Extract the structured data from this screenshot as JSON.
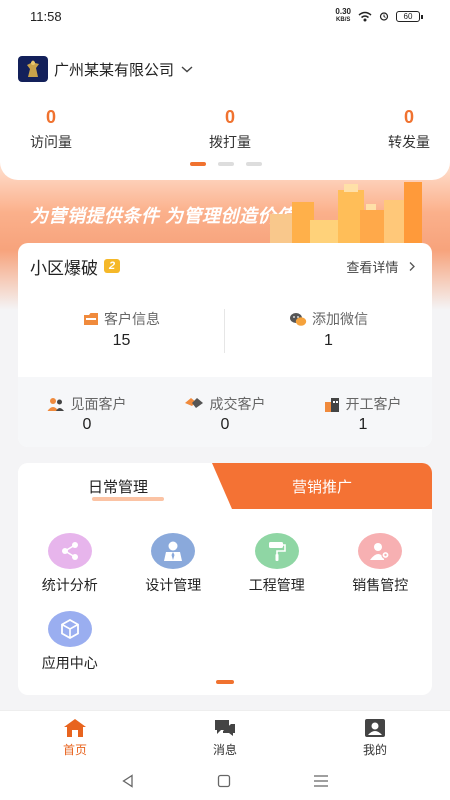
{
  "status_bar": {
    "time": "11:58",
    "net_speed_value": "0.30",
    "net_speed_unit": "KB/S",
    "battery": "60"
  },
  "header": {
    "company_name": "广州某某有限公司",
    "stats": [
      {
        "value": "0",
        "label": "访问量"
      },
      {
        "value": "0",
        "label": "拨打量"
      },
      {
        "value": "0",
        "label": "转发量"
      }
    ]
  },
  "banner": {
    "slogan": "为营销提供条件 为管理创造价值"
  },
  "project": {
    "title": "小区爆破",
    "badge": "2",
    "details_link": "查看详情",
    "customer_info": {
      "label": "客户信息",
      "value": "15"
    },
    "add_wechat": {
      "label": "添加微信",
      "value": "1"
    },
    "meet_customers": {
      "label": "见面客户",
      "value": "0"
    },
    "deal_customers": {
      "label": "成交客户",
      "value": "0"
    },
    "start_customers": {
      "label": "开工客户",
      "value": "1"
    }
  },
  "management": {
    "tabs": {
      "daily": "日常管理",
      "marketing": "营销推广"
    },
    "items": [
      {
        "label": "统计分析",
        "icon": "share-nodes-icon",
        "color": "#e7b5ec"
      },
      {
        "label": "设计管理",
        "icon": "designer-icon",
        "color": "#8aa9db"
      },
      {
        "label": "工程管理",
        "icon": "paint-roller-icon",
        "color": "#8fd6a4"
      },
      {
        "label": "销售管控",
        "icon": "user-gear-icon",
        "color": "#f7b0b2"
      },
      {
        "label": "应用中心",
        "icon": "cube-icon",
        "color": "#9aaef0"
      }
    ]
  },
  "bottom_nav": {
    "home": "首页",
    "messages": "消息",
    "mine": "我的"
  },
  "colors": {
    "accent": "#f0722f"
  }
}
